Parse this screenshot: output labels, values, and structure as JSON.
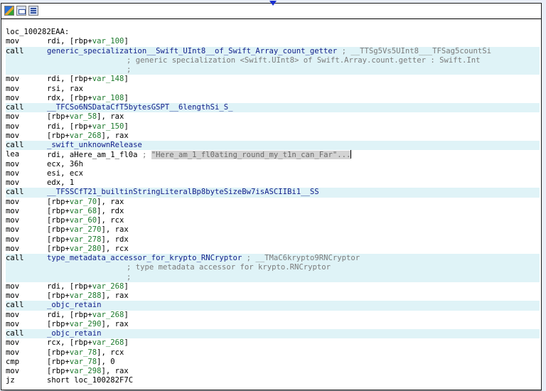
{
  "window": {
    "titlebar_buttons": [
      "graph-overview-icon",
      "edit-color-icon",
      "text-view-icon"
    ]
  },
  "code": {
    "label": "loc_100282EAA:",
    "rows": [
      {
        "hl": false,
        "mn": "mov",
        "ops": [
          [
            "rdi, [rbp+",
            ""
          ],
          [
            "var_100",
            "var"
          ],
          [
            "]",
            ""
          ]
        ]
      },
      {
        "hl": true,
        "mn": "call",
        "ops": [
          [
            "generic_specialization__Swift_UInt8__of_Swift_Array_count_getter",
            "fn"
          ],
          [
            " ; __TTSg5Vs5UInt8___TFSag5countSi",
            "cm"
          ]
        ]
      },
      {
        "hl": true,
        "mn": "",
        "comment": "; generic specialization <Swift.UInt8> of Swift.Array.count.getter : Swift.Int"
      },
      {
        "hl": true,
        "mn": "",
        "comment": ";"
      },
      {
        "hl": false,
        "mn": "mov",
        "ops": [
          [
            "rdi, [rbp+",
            ""
          ],
          [
            "var_148",
            "var"
          ],
          [
            "]",
            ""
          ]
        ]
      },
      {
        "hl": false,
        "mn": "mov",
        "ops": [
          [
            "rsi, rax",
            ""
          ]
        ]
      },
      {
        "hl": false,
        "mn": "mov",
        "ops": [
          [
            "rdx, [rbp+",
            ""
          ],
          [
            "var_108",
            "var"
          ],
          [
            "]",
            ""
          ]
        ]
      },
      {
        "hl": true,
        "mn": "call",
        "ops": [
          [
            "__TFCSo6NSDataCfT5bytesGSPT__6lengthSi_S_",
            "fn"
          ]
        ]
      },
      {
        "hl": false,
        "mn": "mov",
        "ops": [
          [
            "[rbp+",
            ""
          ],
          [
            "var_58",
            "var"
          ],
          [
            "], rax",
            ""
          ]
        ]
      },
      {
        "hl": false,
        "mn": "mov",
        "ops": [
          [
            "rdi, [rbp+",
            ""
          ],
          [
            "var_150",
            "var"
          ],
          [
            "]",
            ""
          ]
        ]
      },
      {
        "hl": false,
        "mn": "mov",
        "ops": [
          [
            "[rbp+",
            ""
          ],
          [
            "var_268",
            "var"
          ],
          [
            "], rax",
            ""
          ]
        ]
      },
      {
        "hl": true,
        "mn": "call",
        "ops": [
          [
            "_swift_unknownRelease",
            "fn"
          ]
        ]
      },
      {
        "hl": false,
        "mn": "lea",
        "ops": [
          [
            "rdi, aHere_am_1_fl0a",
            ""
          ],
          [
            " ; ",
            "cm"
          ],
          [
            "\"Here_am_1_fl0ating_round_my_t1n_can_Far\"...",
            "str"
          ]
        ],
        "caret": true
      },
      {
        "hl": false,
        "mn": "mov",
        "ops": [
          [
            "ecx, 36h",
            ""
          ]
        ]
      },
      {
        "hl": false,
        "mn": "mov",
        "ops": [
          [
            "esi, ecx",
            ""
          ]
        ]
      },
      {
        "hl": false,
        "mn": "mov",
        "ops": [
          [
            "edx, 1",
            ""
          ]
        ]
      },
      {
        "hl": true,
        "mn": "call",
        "ops": [
          [
            "__TFSSCfT21_builtinStringLiteralBp8byteSizeBw7isASCIIBi1__SS",
            "fn"
          ]
        ]
      },
      {
        "hl": false,
        "mn": "mov",
        "ops": [
          [
            "[rbp+",
            ""
          ],
          [
            "var_70",
            "var"
          ],
          [
            "], rax",
            ""
          ]
        ]
      },
      {
        "hl": false,
        "mn": "mov",
        "ops": [
          [
            "[rbp+",
            ""
          ],
          [
            "var_68",
            "var"
          ],
          [
            "], rdx",
            ""
          ]
        ]
      },
      {
        "hl": false,
        "mn": "mov",
        "ops": [
          [
            "[rbp+",
            ""
          ],
          [
            "var_60",
            "var"
          ],
          [
            "], rcx",
            ""
          ]
        ]
      },
      {
        "hl": false,
        "mn": "mov",
        "ops": [
          [
            "[rbp+",
            ""
          ],
          [
            "var_270",
            "var"
          ],
          [
            "], rax",
            ""
          ]
        ]
      },
      {
        "hl": false,
        "mn": "mov",
        "ops": [
          [
            "[rbp+",
            ""
          ],
          [
            "var_278",
            "var"
          ],
          [
            "], rdx",
            ""
          ]
        ]
      },
      {
        "hl": false,
        "mn": "mov",
        "ops": [
          [
            "[rbp+",
            ""
          ],
          [
            "var_280",
            "var"
          ],
          [
            "], rcx",
            ""
          ]
        ]
      },
      {
        "hl": true,
        "mn": "call",
        "ops": [
          [
            "type_metadata_accessor_for_krypto_RNCryptor",
            "fn"
          ],
          [
            " ; __TMaC6krypto9RNCryptor",
            "cm"
          ]
        ]
      },
      {
        "hl": true,
        "mn": "",
        "comment": "; type metadata accessor for krypto.RNCryptor"
      },
      {
        "hl": true,
        "mn": "",
        "comment": ";"
      },
      {
        "hl": false,
        "mn": "mov",
        "ops": [
          [
            "rdi, [rbp+",
            ""
          ],
          [
            "var_268",
            "var"
          ],
          [
            "]",
            ""
          ]
        ]
      },
      {
        "hl": false,
        "mn": "mov",
        "ops": [
          [
            "[rbp+",
            ""
          ],
          [
            "var_288",
            "var"
          ],
          [
            "], rax",
            ""
          ]
        ]
      },
      {
        "hl": true,
        "mn": "call",
        "ops": [
          [
            "_objc_retain",
            "fn"
          ]
        ]
      },
      {
        "hl": false,
        "mn": "mov",
        "ops": [
          [
            "rdi, [rbp+",
            ""
          ],
          [
            "var_268",
            "var"
          ],
          [
            "]",
            ""
          ]
        ]
      },
      {
        "hl": false,
        "mn": "mov",
        "ops": [
          [
            "[rbp+",
            ""
          ],
          [
            "var_290",
            "var"
          ],
          [
            "], rax",
            ""
          ]
        ]
      },
      {
        "hl": true,
        "mn": "call",
        "ops": [
          [
            "_objc_retain",
            "fn"
          ]
        ]
      },
      {
        "hl": false,
        "mn": "mov",
        "ops": [
          [
            "rcx, [rbp+",
            ""
          ],
          [
            "var_268",
            "var"
          ],
          [
            "]",
            ""
          ]
        ]
      },
      {
        "hl": false,
        "mn": "mov",
        "ops": [
          [
            "[rbp+",
            ""
          ],
          [
            "var_78",
            "var"
          ],
          [
            "], rcx",
            ""
          ]
        ]
      },
      {
        "hl": false,
        "mn": "cmp",
        "ops": [
          [
            "[rbp+",
            ""
          ],
          [
            "var_78",
            "var"
          ],
          [
            "], 0",
            ""
          ]
        ]
      },
      {
        "hl": false,
        "mn": "mov",
        "ops": [
          [
            "[rbp+",
            ""
          ],
          [
            "var_298",
            "var"
          ],
          [
            "], rax",
            ""
          ]
        ]
      },
      {
        "hl": false,
        "mn": "jz",
        "ops": [
          [
            "short loc_100282F7C",
            ""
          ]
        ]
      }
    ]
  },
  "colors": {
    "highlight": "#dff3f7",
    "function_name": "#101e8a",
    "variable": "#1c7a2c",
    "comment": "#7b7b7b",
    "edge_arrow": "#1a2fd0"
  }
}
